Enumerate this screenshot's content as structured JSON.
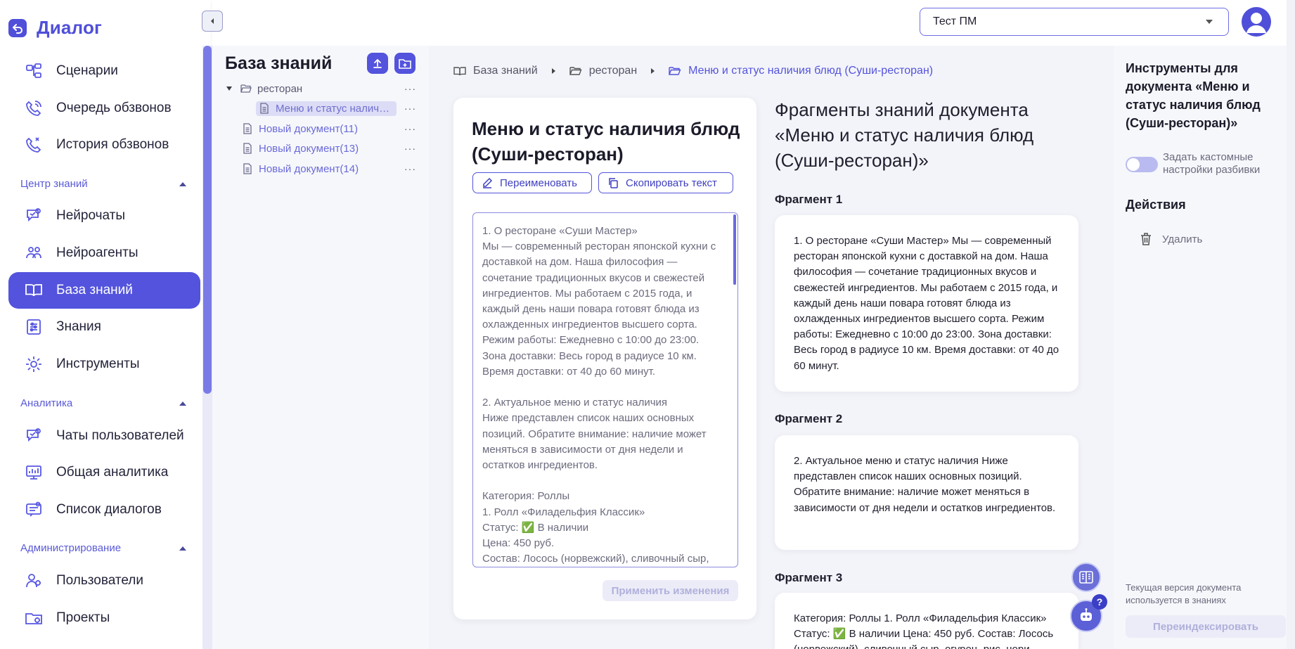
{
  "app": {
    "title": "Диалог"
  },
  "sidebar": {
    "items": [
      {
        "label": "Сценарии",
        "icon": "scenarios-icon"
      },
      {
        "label": "Очередь обзвонов",
        "icon": "phone-queue-icon"
      },
      {
        "label": "История обзвонов",
        "icon": "phone-history-icon"
      }
    ],
    "sections": [
      {
        "title": "Центр знаний",
        "items": [
          {
            "label": "Нейрочаты",
            "icon": "neurochat-icon"
          },
          {
            "label": "Нейроагенты",
            "icon": "neuroagent-icon"
          },
          {
            "label": "База знаний",
            "icon": "book-icon",
            "active": true
          },
          {
            "label": "Знания",
            "icon": "sliders-icon"
          },
          {
            "label": "Инструменты",
            "icon": "gear-icon"
          }
        ]
      },
      {
        "title": "Аналитика",
        "items": [
          {
            "label": "Чаты пользователей",
            "icon": "user-chats-icon"
          },
          {
            "label": "Общая аналитика",
            "icon": "analytics-icon"
          },
          {
            "label": "Список диалогов",
            "icon": "dialog-list-icon"
          }
        ]
      },
      {
        "title": "Администрирование",
        "items": [
          {
            "label": "Пользователи",
            "icon": "users-icon"
          },
          {
            "label": "Проекты",
            "icon": "projects-icon"
          }
        ]
      }
    ]
  },
  "header": {
    "project_select": {
      "value": "Тест ПМ"
    }
  },
  "tree": {
    "title": "База знаний",
    "folder": "ресторан",
    "items": [
      {
        "label": "Меню и статус наличия ...",
        "selected": true
      },
      {
        "label": "Новый документ(11)"
      },
      {
        "label": "Новый документ(13)"
      },
      {
        "label": "Новый документ(14)"
      }
    ],
    "more": "···"
  },
  "breadcrumb": {
    "items": [
      "База знаний",
      "ресторан",
      "Меню и статус наличия блюд (Суши-ресторан)"
    ]
  },
  "document": {
    "title": "Меню и статус наличия блюд (Суши-ресторан)",
    "rename_label": "Переименовать",
    "copy_label": "Скопировать текст",
    "text": "1. О ресторане «Суши Мастер»\nМы — современный ресторан японской кухни с доставкой на дом. Наша философия — сочетание традиционных вкусов и свежестей ингредиентов. Мы работаем с 2015 года, и каждый день наши повара готовят блюда из охлажденных ингредиентов высшего сорта.\nРежим работы: Ежедневно с 10:00 до 23:00.\nЗона доставки: Весь город в радиусе 10 км.\nВремя доставки: от 40 до 60 минут.\n\n2. Актуальное меню и статус наличия\nНиже представлен список наших основных позиций. Обратите внимание: наличие может меняться в зависимости от дня недели и остатков ингредиентов.\n\nКатегория: Роллы\n1. Ролл «Филадельфия Классик»\nСтатус: ✅ В наличии\nЦена: 450 руб.\nСостав: Лосось (норвежский), сливочный сыр,",
    "apply_label": "Применить изменения"
  },
  "fragments": {
    "heading": "Фрагменты знаний документа «Меню и статус наличия блюд (Суши-ресторан)»",
    "items": [
      {
        "label": "Фрагмент 1",
        "text": "1. О ресторане «Суши Мастер» Мы — современный ресторан японской кухни с доставкой на дом. Наша философия — сочетание традиционных вкусов и свежестей ингредиентов. Мы работаем с 2015 года, и каждый день наши повара готовят блюда из охлажденных ингредиентов высшего сорта. Режим работы: Ежедневно с 10:00 до 23:00. Зона доставки: Весь город в радиусе 10 км. Время доставки: от 40 до 60 минут."
      },
      {
        "label": "Фрагмент 2",
        "text": "2. Актуальное меню и статус наличия Ниже представлен список наших основных позиций. Обратите внимание: наличие может меняться в зависимости от дня недели и остатков ингредиентов."
      },
      {
        "label": "Фрагмент 3",
        "text": "Категория: Роллы 1. Ролл «Филадельфия Классик» Статус: ✅ В наличии Цена: 450 руб. Состав: Лосось (норвежский), сливочный сыр, огурец, рис, нори."
      }
    ]
  },
  "tools": {
    "title": "Инструменты для документа «Меню и статус наличия блюд (Суши-ресторан)»",
    "toggle_label": "Задать кастомные настройки разбивки",
    "toggle_on": false,
    "actions_title": "Действия",
    "delete_label": "Удалить",
    "version_note": "Текущая версия документа используется в знаниях",
    "reindex_label": "Переиндексировать"
  },
  "colors": {
    "accent": "#5353dd",
    "panel_bg": "#f6f7fb",
    "content_bg": "#f3f4f9"
  }
}
